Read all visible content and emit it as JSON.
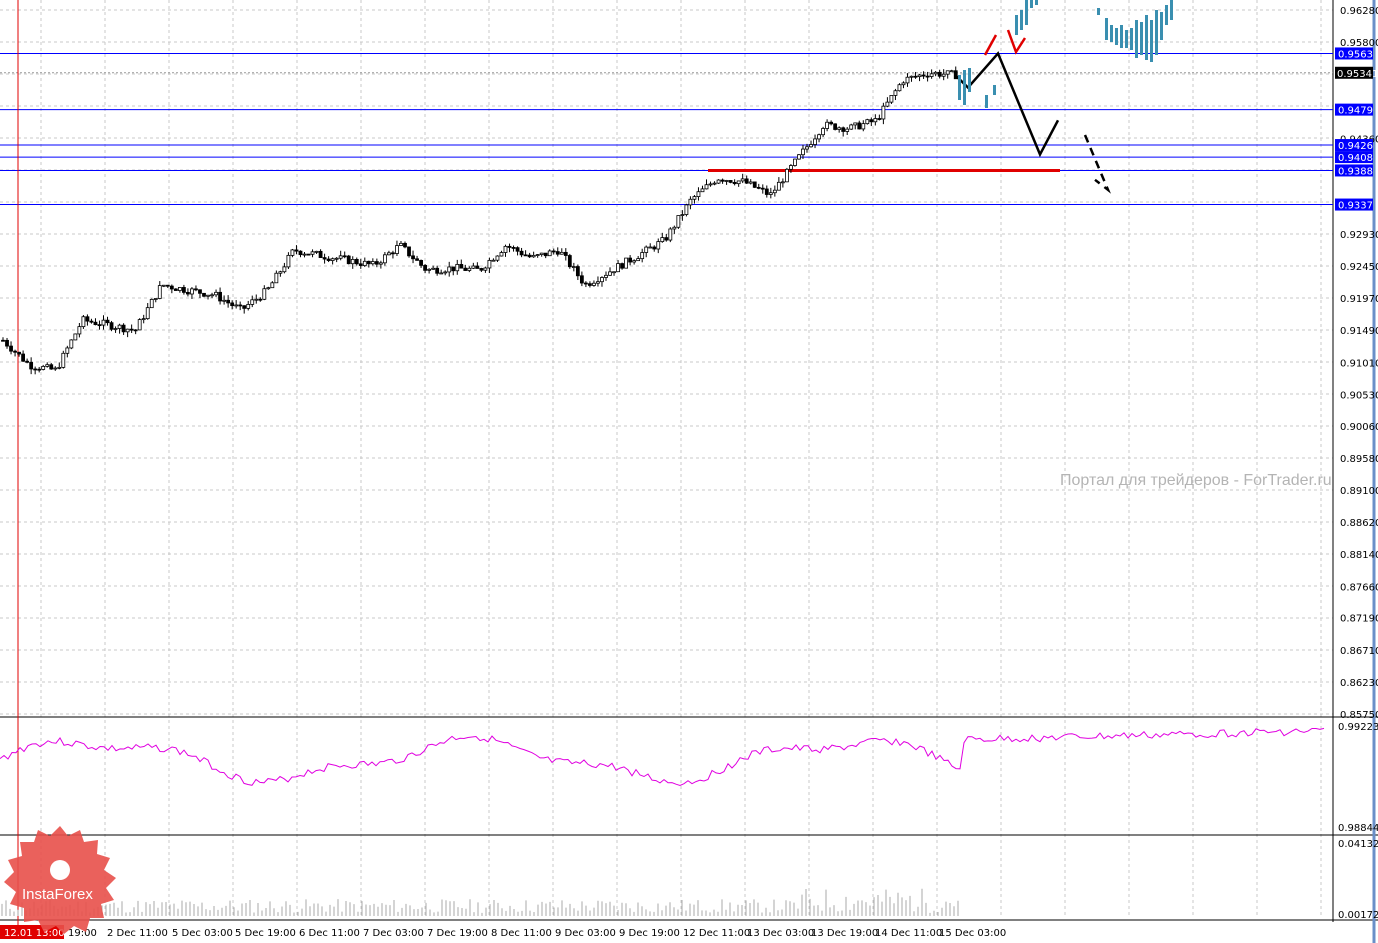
{
  "chart_data": {
    "type": "candlestick",
    "title": "",
    "price_axis_ticks": [
      "0.96280",
      "0.95800",
      "0.95341",
      "0.94360",
      "0.92930",
      "0.92450",
      "0.91970",
      "0.91490",
      "0.91010",
      "0.90530",
      "0.90060",
      "0.89580",
      "0.89100",
      "0.88620",
      "0.88140",
      "0.87660",
      "0.87190",
      "0.86710",
      "0.86230",
      "0.85750"
    ],
    "ylim": [
      0.8575,
      0.9628
    ],
    "time_axis_ticks": [
      "12.01 13:00",
      "19:00",
      "2 Dec 11:00",
      "5 Dec 03:00",
      "5 Dec 19:00",
      "6 Dec 11:00",
      "7 Dec 03:00",
      "7 Dec 19:00",
      "8 Dec 11:00",
      "9 Dec 03:00",
      "9 Dec 19:00",
      "12 Dec 11:00",
      "13 Dec 03:00",
      "13 Dec 19:00",
      "14 Dec 11:00",
      "15 Dec 03:00"
    ],
    "close_path": [
      0.9134,
      0.9097,
      0.9089,
      0.9164,
      0.9157,
      0.9149,
      0.9217,
      0.9209,
      0.9202,
      0.9179,
      0.9209,
      0.9269,
      0.9261,
      0.9254,
      0.9246,
      0.9276,
      0.9239,
      0.9242,
      0.9239,
      0.9276,
      0.9257,
      0.9269,
      0.9217,
      0.9239,
      0.9261,
      0.9284,
      0.9344,
      0.9377,
      0.9371,
      0.9351,
      0.9404,
      0.9456,
      0.9451,
      0.9463,
      0.9523,
      0.9534,
      0.9531
    ],
    "current_price": "0.95341",
    "levels": [
      {
        "label": "0.9563",
        "value": 0.9563
      },
      {
        "label": "0.9479",
        "value": 0.9479
      },
      {
        "label": "0.9426",
        "value": 0.9426
      },
      {
        "label": "0.9408",
        "value": 0.9408
      },
      {
        "label": "0.9388",
        "value": 0.9388
      },
      {
        "label": "0.9337",
        "value": 0.9337
      }
    ],
    "support_line": {
      "value": 0.9388,
      "color": "#e00000"
    },
    "forecast_path": [
      0.9531,
      0.9512,
      0.9563,
      0.9412,
      0.9463
    ],
    "forecast_dashed": [
      0.9441,
      0.9359,
      0.9374
    ],
    "oscillator": {
      "max_label": "0.99223",
      "min_label": "0.98844",
      "color": "#e000e0"
    },
    "volume": {
      "max_label": "0.04132",
      "min_label": "0.00172",
      "zero_label": "0.00"
    },
    "colors": {
      "level": "#0000ff",
      "tag": "#0000ff",
      "grid": "#c0c0c0",
      "histogram": "#3a8fb0"
    }
  },
  "watermark": "Портал для трейдеров - ForTrader.ru",
  "logo": "InstaForex"
}
